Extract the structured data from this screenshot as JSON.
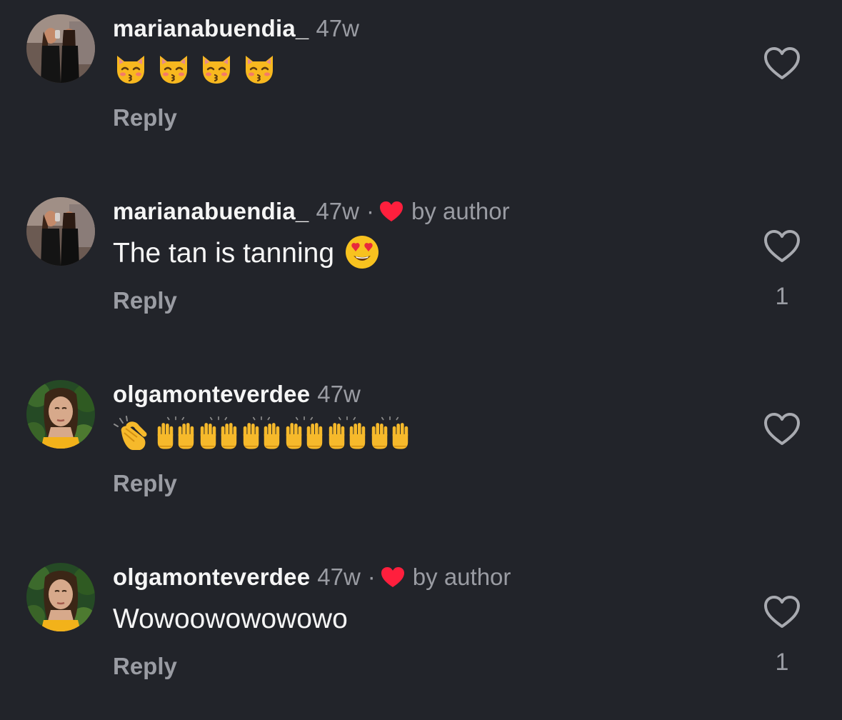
{
  "colors": {
    "background": "#22242a",
    "primary_text": "#f5f5f5",
    "secondary_text": "#9a9ca3",
    "author_heart": "#ff1f3d"
  },
  "comments": [
    {
      "username": "marianabuendia_",
      "time": "47w",
      "liked_by_author": false,
      "by_author_label": "",
      "text": "",
      "emojis": [
        "kissing-cat-emoji",
        "kissing-cat-emoji",
        "kissing-cat-emoji",
        "kissing-cat-emoji"
      ],
      "reply_label": "Reply",
      "like_count": ""
    },
    {
      "username": "marianabuendia_",
      "time": "47w",
      "liked_by_author": true,
      "separator": "·",
      "by_author_label": "by author",
      "text": "The tan is tanning",
      "emojis": [
        "heart-eyes-emoji"
      ],
      "reply_label": "Reply",
      "like_count": "1"
    },
    {
      "username": "olgamonteverdee",
      "time": "47w",
      "liked_by_author": false,
      "by_author_label": "",
      "text": "",
      "emojis": [
        "clapping-hands-emoji",
        "raising-hands-emoji",
        "raising-hands-emoji",
        "raising-hands-emoji",
        "raising-hands-emoji",
        "raising-hands-emoji",
        "raising-hands-emoji"
      ],
      "reply_label": "Reply",
      "like_count": ""
    },
    {
      "username": "olgamonteverdee",
      "time": "47w",
      "liked_by_author": true,
      "separator": "·",
      "by_author_label": "by author",
      "text": "Wowoowowowowo",
      "emojis": [],
      "reply_label": "Reply",
      "like_count": "1"
    }
  ]
}
